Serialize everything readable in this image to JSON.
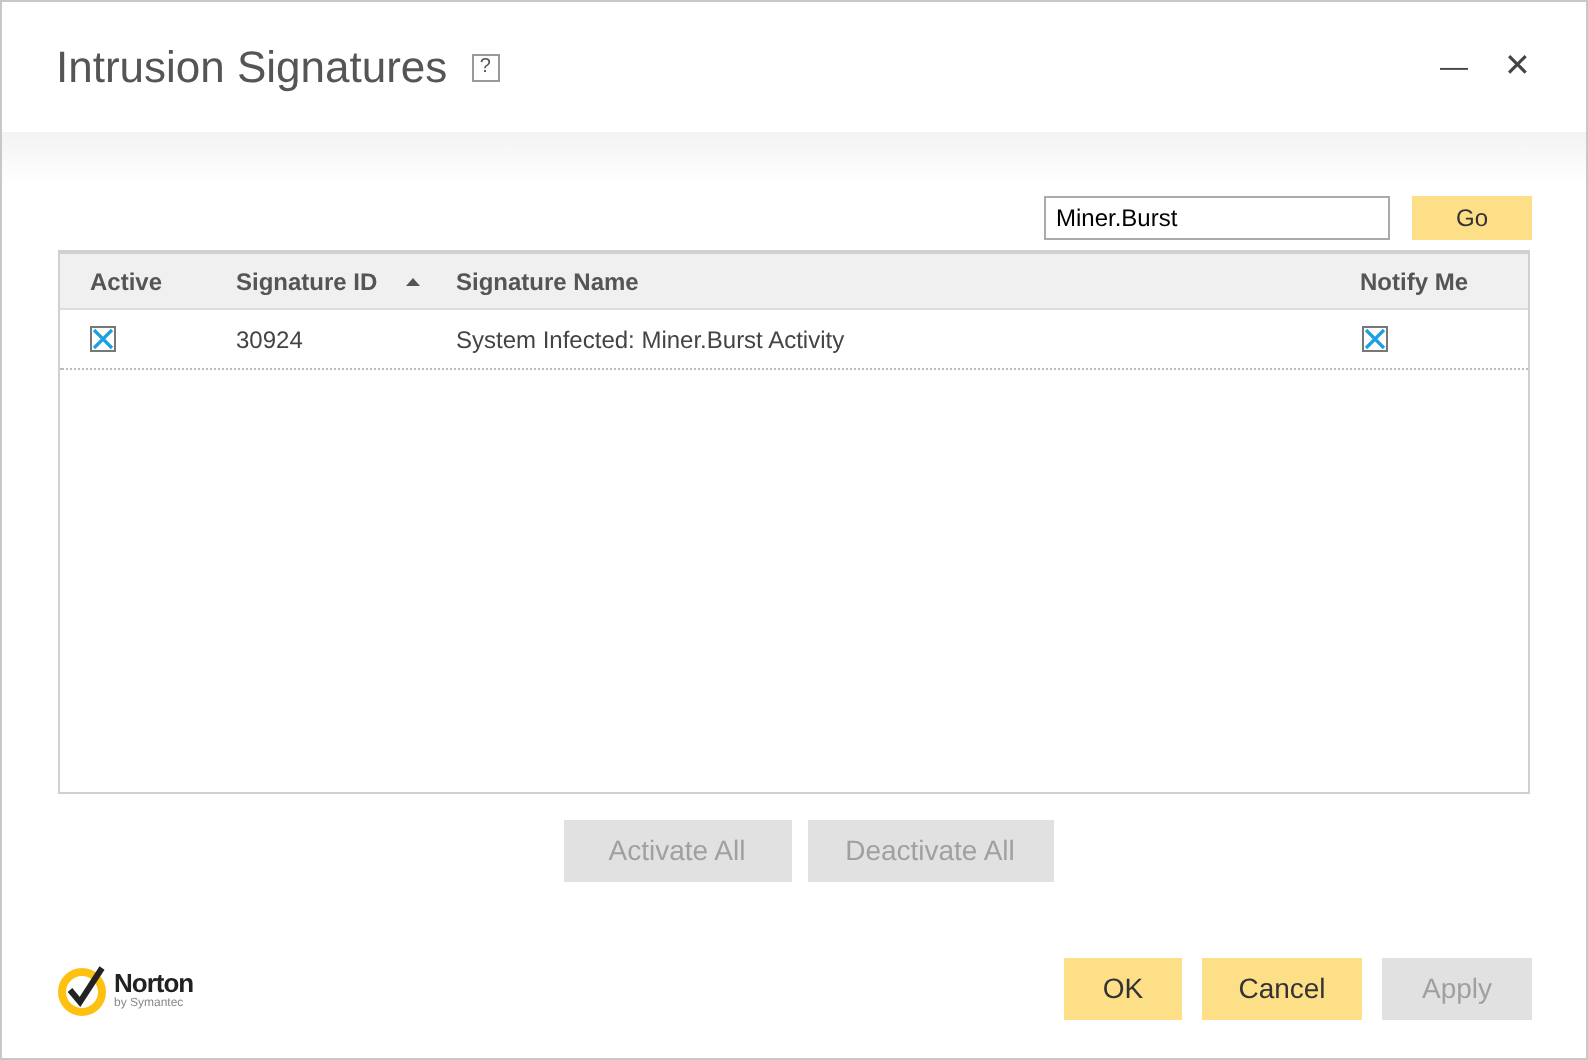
{
  "window": {
    "title": "Intrusion Signatures",
    "help": "?",
    "minimize": "—",
    "close": "✕"
  },
  "search": {
    "value": "Miner.Burst",
    "button": "Go"
  },
  "table": {
    "columns": [
      {
        "label": "Active",
        "sorted": false
      },
      {
        "label": "Signature ID",
        "sorted": true
      },
      {
        "label": "Signature Name",
        "sorted": false
      },
      {
        "label": "Notify Me",
        "sorted": false
      }
    ],
    "rows": [
      {
        "active": true,
        "id": "30924",
        "name": "System Infected: Miner.Burst Activity",
        "notify": true
      }
    ]
  },
  "table_buttons": [
    {
      "label": "Activate All",
      "disabled": true
    },
    {
      "label": "Deactivate All",
      "disabled": true
    }
  ],
  "logo": {
    "name": "Norton",
    "tagline": "by Symantec"
  },
  "buttons": [
    {
      "label": "OK",
      "disabled": false
    },
    {
      "label": "Cancel",
      "disabled": false
    },
    {
      "label": "Apply",
      "disabled": true
    }
  ]
}
